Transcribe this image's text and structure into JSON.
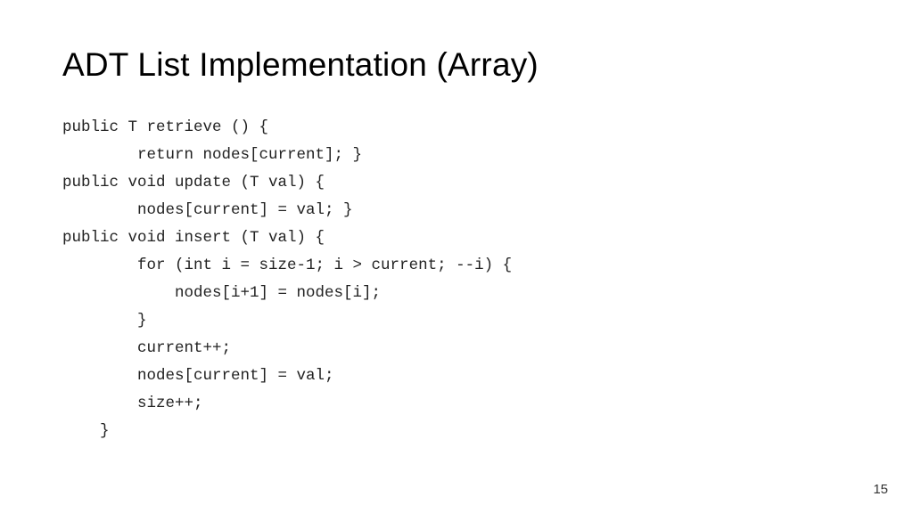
{
  "title": "ADT List Implementation (Array)",
  "code_lines": [
    "public T retrieve () {",
    "        return nodes[current]; }",
    "public void update (T val) {",
    "        nodes[current] = val; }",
    "public void insert (T val) {",
    "        for (int i = size-1; i > current; --i) {",
    "            nodes[i+1] = nodes[i];",
    "        }",
    "        current++;",
    "        nodes[current] = val;",
    "        size++;",
    "    }"
  ],
  "page_number": "15"
}
